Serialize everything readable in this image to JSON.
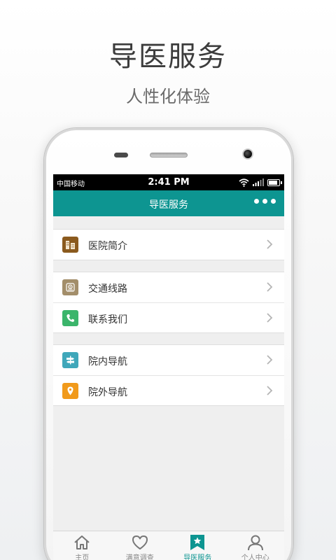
{
  "promo": {
    "title": "导医服务",
    "subtitle": "人性化体验"
  },
  "status_bar": {
    "carrier": "中国移动",
    "time": "2:41 PM",
    "icons": [
      "wifi-icon",
      "signal-icon",
      "battery-icon"
    ]
  },
  "nav": {
    "title": "导医服务",
    "more_icon": "more-dots-icon",
    "color": "#0d9591"
  },
  "groups": [
    {
      "items": [
        {
          "label": "医院简介",
          "icon": "building-icon",
          "icon_color": "#8b5a1e"
        }
      ]
    },
    {
      "items": [
        {
          "label": "交通线路",
          "icon": "map-pin-icon",
          "icon_color": "#a38e6a"
        },
        {
          "label": "联系我们",
          "icon": "phone-icon",
          "icon_color": "#3bb56b"
        }
      ]
    },
    {
      "items": [
        {
          "label": "院内导航",
          "icon": "signpost-icon",
          "icon_color": "#3fa7ba"
        },
        {
          "label": "院外导航",
          "icon": "location-icon",
          "icon_color": "#f19a1b"
        }
      ]
    }
  ],
  "tab_bar": {
    "active_color": "#0d9591",
    "tabs": [
      {
        "label": "主页",
        "icon": "home-icon"
      },
      {
        "label": "满意调查",
        "icon": "heart-icon"
      },
      {
        "label": "导医服务",
        "icon": "bookmark-star-icon",
        "active": true
      },
      {
        "label": "个人中心",
        "icon": "user-icon"
      }
    ]
  }
}
